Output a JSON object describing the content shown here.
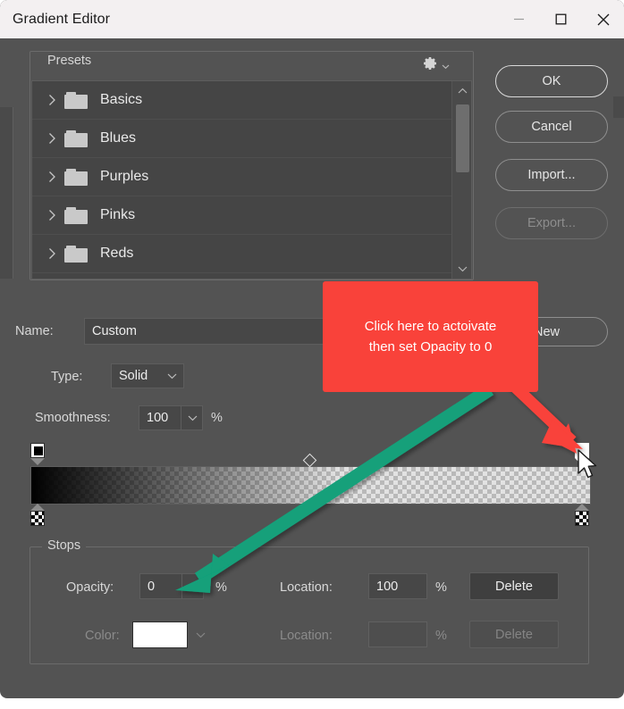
{
  "window": {
    "title": "Gradient Editor",
    "minimize_icon": "minimize-icon",
    "maximize_icon": "maximize-icon",
    "close_icon": "close-icon",
    "bg_color": "#535353",
    "titlebar_color": "#f3f0f1"
  },
  "presets": {
    "legend": "Presets",
    "gear_icon": "gear-icon",
    "items": [
      {
        "label": "Basics",
        "icon": "folder-icon",
        "chevron": "chevron-right-icon"
      },
      {
        "label": "Blues",
        "icon": "folder-icon",
        "chevron": "chevron-right-icon"
      },
      {
        "label": "Purples",
        "icon": "folder-icon",
        "chevron": "chevron-right-icon"
      },
      {
        "label": "Pinks",
        "icon": "folder-icon",
        "chevron": "chevron-right-icon"
      },
      {
        "label": "Reds",
        "icon": "folder-icon",
        "chevron": "chevron-right-icon"
      }
    ],
    "scrollbar": {
      "up_icon": "chevron-up-icon",
      "down_icon": "chevron-down-icon"
    }
  },
  "buttons": {
    "ok": "OK",
    "cancel": "Cancel",
    "import": "Import...",
    "export": "Export...",
    "new": "New"
  },
  "name_row": {
    "label": "Name:",
    "value": "Custom"
  },
  "type_row": {
    "label": "Type:",
    "value": "Solid",
    "arrow_icon": "chevron-down-icon"
  },
  "smoothness_row": {
    "label": "Smoothness:",
    "value": "100",
    "unit": "%",
    "arrow_icon": "chevron-down-icon"
  },
  "gradient": {
    "midpoint_icon": "midpoint-diamond-icon",
    "opacity_stops": [
      {
        "position_pct": 0,
        "state": "normal",
        "swatch": "black"
      },
      {
        "position_pct": 100,
        "state": "selected",
        "swatch": "white"
      }
    ],
    "color_stops": [
      {
        "position_pct": 0,
        "state": "normal",
        "swatch": "checker"
      },
      {
        "position_pct": 100,
        "state": "normal",
        "swatch": "checker"
      }
    ]
  },
  "stops": {
    "legend": "Stops",
    "opacity": {
      "label": "Opacity:",
      "value": "0",
      "unit": "%",
      "arrow_icon": "chevron-down-icon",
      "enabled": true
    },
    "opacity_location": {
      "label": "Location:",
      "value": "100",
      "unit": "%",
      "enabled": true
    },
    "opacity_delete": {
      "label": "Delete",
      "enabled": true
    },
    "color": {
      "label": "Color:",
      "value": "",
      "swatch_color": "#ffffff",
      "arrow_icon": "chevron-down-icon",
      "enabled": false
    },
    "color_location": {
      "label": "Location:",
      "value": "",
      "unit": "%",
      "enabled": false
    },
    "color_delete": {
      "label": "Delete",
      "enabled": false
    }
  },
  "annotations": {
    "callout": {
      "line1": "Click here to actoivate",
      "line2": "then set Opacity to 0",
      "bg_color": "#f9423a",
      "text_color": "#ffffff"
    },
    "red_arrow": {
      "color": "#f9423a",
      "points_to": "opacity-stop-right"
    },
    "teal_arrow": {
      "color": "#12a07a",
      "points_to": "opacity-value-field"
    },
    "cursor": {
      "icon": "mouse-pointer-icon"
    }
  }
}
